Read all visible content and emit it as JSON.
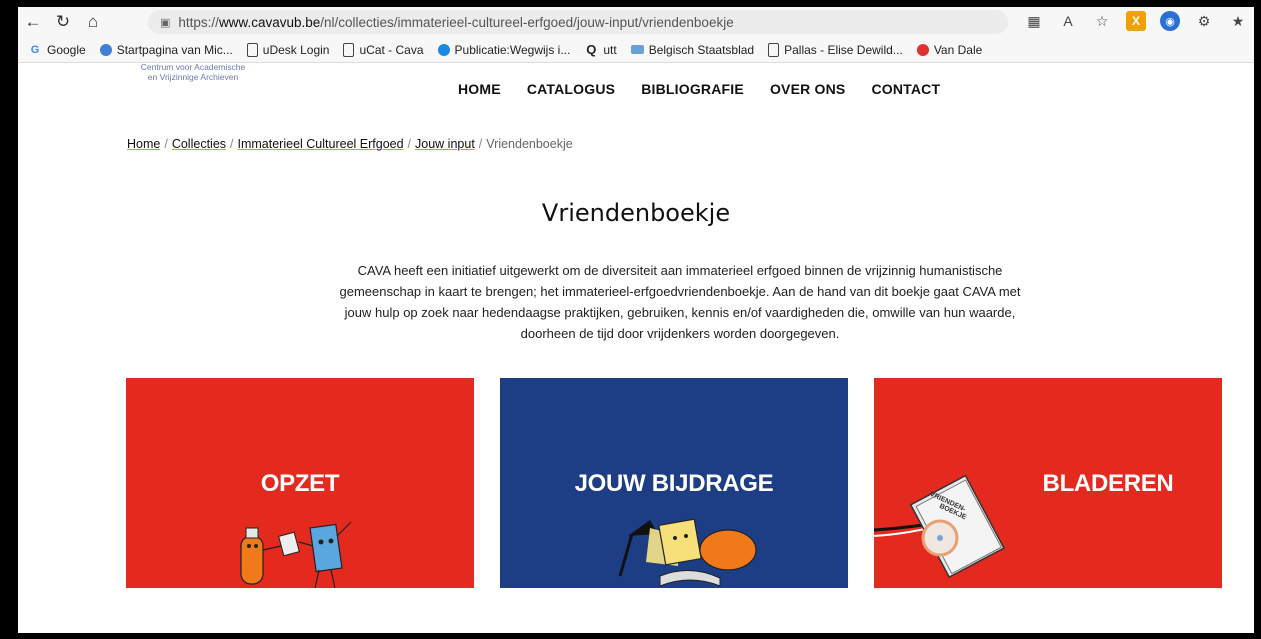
{
  "browser": {
    "url_prefix": "https://",
    "url_host": "www.cavavub.be",
    "url_path": "/nl/collecties/immaterieel-cultureel-erfgoed/jouw-input/vriendenboekje",
    "bookmarks": [
      {
        "label": "Google",
        "icon": "google-icon"
      },
      {
        "label": "Startpagina van Mic...",
        "icon": "microsoft-icon"
      },
      {
        "label": "uDesk Login",
        "icon": "page-icon"
      },
      {
        "label": "uCat - Cava",
        "icon": "page-icon"
      },
      {
        "label": "Publicatie:Wegwijs i...",
        "icon": "blue-dot-icon"
      },
      {
        "label": "utt",
        "icon": "q-icon"
      },
      {
        "label": "Belgisch Staatsblad",
        "icon": "flag-icon"
      },
      {
        "label": "Pallas - Elise Dewild...",
        "icon": "page-icon"
      },
      {
        "label": "Van Dale",
        "icon": "vandale-icon"
      }
    ]
  },
  "site": {
    "logo_line1": "Centrum voor Academische",
    "logo_line2": "en Vrijzinnige Archieven",
    "nav": [
      "HOME",
      "CATALOGUS",
      "BIBLIOGRAFIE",
      "OVER ONS",
      "CONTACT"
    ]
  },
  "breadcrumb": {
    "items": [
      "Home",
      "Collecties",
      "Immaterieel Cultureel Erfgoed",
      "Jouw input"
    ],
    "current": "Vriendenboekje",
    "separator": "/"
  },
  "page": {
    "title": "Vriendenboekje",
    "intro": "CAVA heeft een initiatief uitgewerkt om de diversiteit aan immaterieel erfgoed binnen de vrijzinnig humanistische gemeenschap in kaart te brengen; het immaterieel-erfgoedvriendenboekje. Aan de hand van dit boekje gaat CAVA met jouw hulp op zoek naar hedendaagse praktijken, gebruiken, kennis en/of vaardigheden die, omwille van hun waarde, doorheen de tijd door vrijdenkers worden doorgegeven."
  },
  "cards": [
    {
      "label": "OPZET",
      "color": "#e4291f"
    },
    {
      "label": "JOUW BIJDRAGE",
      "color": "#1d3e85"
    },
    {
      "label": "BLADEREN",
      "color": "#e4291f"
    }
  ],
  "book_cover_text": [
    "VRIENDEN-",
    "BOEKJE"
  ]
}
